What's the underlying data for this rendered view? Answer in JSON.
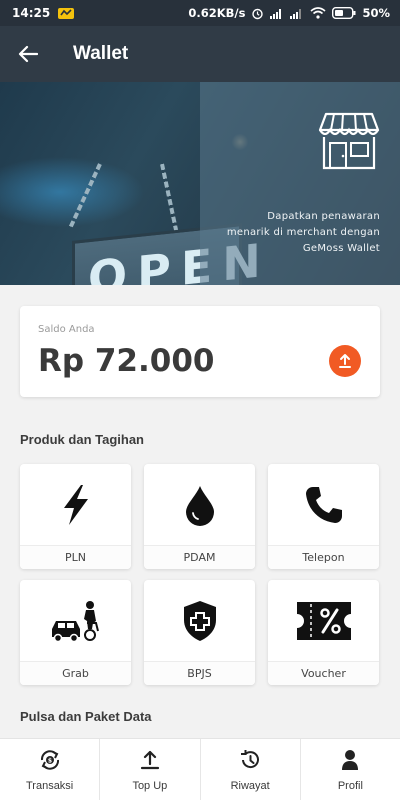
{
  "status_bar": {
    "time": "14:25",
    "network_speed": "0.62KB/s",
    "battery": "50%"
  },
  "app_bar": {
    "title": "Wallet",
    "back_icon": "arrow-left-icon"
  },
  "hero": {
    "sign_text": "OPEN",
    "icon": "store-icon",
    "promo_line1": "Dapatkan penawaran",
    "promo_line2": "menarik di merchant dengan",
    "promo_line3": "GeMoss Wallet"
  },
  "balance": {
    "label": "Saldo Anda",
    "amount": "Rp 72.000",
    "topup_icon": "upload-icon",
    "accent": "#f15a24"
  },
  "products": {
    "title": "Produk dan Tagihan",
    "items": [
      {
        "label": "PLN",
        "icon": "lightning-icon"
      },
      {
        "label": "PDAM",
        "icon": "water-drop-icon"
      },
      {
        "label": "Telepon",
        "icon": "phone-icon"
      },
      {
        "label": "Grab",
        "icon": "car-rider-icon"
      },
      {
        "label": "BPJS",
        "icon": "shield-cross-icon"
      },
      {
        "label": "Voucher",
        "icon": "voucher-percent-icon"
      }
    ]
  },
  "pulsa": {
    "title": "Pulsa dan Paket Data"
  },
  "bottom_nav": {
    "items": [
      {
        "label": "Transaksi",
        "icon": "coin-exchange-icon"
      },
      {
        "label": "Top Up",
        "icon": "upload-icon"
      },
      {
        "label": "Riwayat",
        "icon": "history-icon"
      },
      {
        "label": "Profil",
        "icon": "person-icon"
      }
    ]
  },
  "colors": {
    "app_bar": "#303b46",
    "status_bar": "#28313b",
    "accent": "#f15a24"
  }
}
